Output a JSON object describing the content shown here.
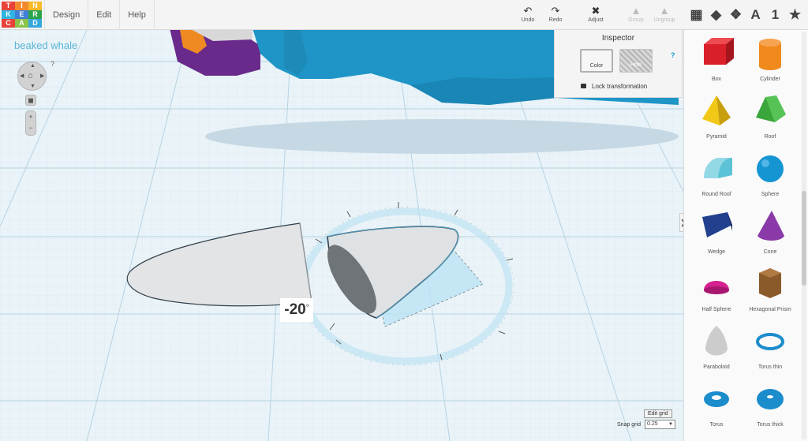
{
  "logo": {
    "letters": [
      "T",
      "I",
      "N",
      "K",
      "E",
      "R",
      "C",
      "A",
      "D"
    ],
    "colors": [
      "#e8423b",
      "#f18a2c",
      "#f7b928",
      "#2db4e0",
      "#3f7fd6",
      "#2da44a",
      "#e8423b",
      "#8bc34a",
      "#35a8dc"
    ]
  },
  "menu": [
    {
      "label": "Design"
    },
    {
      "label": "Edit"
    },
    {
      "label": "Help"
    }
  ],
  "toolbar": {
    "undo": {
      "label": "Undo",
      "icon": "undo-icon"
    },
    "redo": {
      "label": "Redo",
      "icon": "redo-icon"
    },
    "adjust": {
      "label": "Adjust",
      "icon": "adjust-icon"
    },
    "group": {
      "label": "Group",
      "icon": "group-icon"
    },
    "ungroup": {
      "label": "Ungroup",
      "icon": "ungroup-icon"
    }
  },
  "view_icons": [
    {
      "name": "grid-view-icon",
      "glyph": "▦"
    },
    {
      "name": "cube-view-icon",
      "glyph": "◆"
    },
    {
      "name": "box-pattern-icon",
      "glyph": "❖"
    },
    {
      "name": "text-shape-icon",
      "glyph": "A"
    },
    {
      "name": "number-shape-icon",
      "glyph": "1"
    },
    {
      "name": "favorite-star-icon",
      "glyph": "★"
    }
  ],
  "document": {
    "title": "beaked whale"
  },
  "workplane": {
    "help": "?",
    "rotation": "-20",
    "degree": "°"
  },
  "inspector": {
    "title": "Inspector",
    "color_label": "Color",
    "hole_label": "Hole",
    "help": "?",
    "lock_label": "Lock transformation"
  },
  "grid": {
    "edit_label": "Edit grid",
    "snap_label": "Snap grid",
    "snap_value": "0.25"
  },
  "shapes": [
    {
      "label": "Box",
      "icon": "box-icon",
      "color": "#d9202a"
    },
    {
      "label": "Cylinder",
      "icon": "cylinder-icon",
      "color": "#f08a1c"
    },
    {
      "label": "Pyramid",
      "icon": "pyramid-icon",
      "color": "#f2c816"
    },
    {
      "label": "Roof",
      "icon": "roof-icon",
      "color": "#3aa53a"
    },
    {
      "label": "Round Roof",
      "icon": "round-roof-icon",
      "color": "#5cc3d6"
    },
    {
      "label": "Sphere",
      "icon": "sphere-icon",
      "color": "#1695d3"
    },
    {
      "label": "Wedge",
      "icon": "wedge-icon",
      "color": "#23408e"
    },
    {
      "label": "Cone",
      "icon": "cone-icon",
      "color": "#8a3aa8"
    },
    {
      "label": "Half Sphere",
      "icon": "half-sphere-icon",
      "color": "#d6208e"
    },
    {
      "label": "Hexagonal Prism",
      "icon": "hexagonal-prism-icon",
      "color": "#8b5a2b"
    },
    {
      "label": "Paraboloid",
      "icon": "paraboloid-icon",
      "color": "#cccccc"
    },
    {
      "label": "Torus thin",
      "icon": "torus-thin-icon",
      "color": "#1b8ccc"
    },
    {
      "label": "Torus",
      "icon": "torus-icon",
      "color": "#1b8ccc"
    },
    {
      "label": "Torus thick",
      "icon": "torus-thick-icon",
      "color": "#1b8ccc"
    }
  ]
}
